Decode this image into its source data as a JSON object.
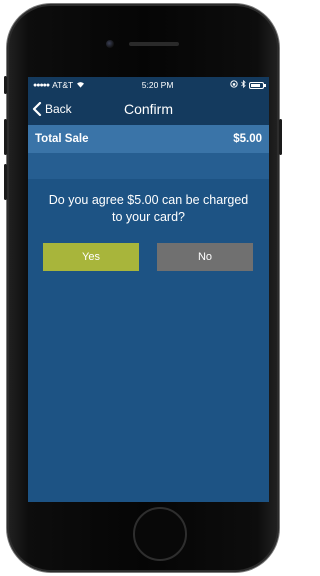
{
  "status_bar": {
    "carrier": "AT&T",
    "signal_dots": "●●●●●",
    "time": "5:20 PM"
  },
  "nav": {
    "back_label": "Back",
    "title": "Confirm"
  },
  "sale": {
    "label": "Total Sale",
    "amount": "$5.00"
  },
  "prompt": {
    "text": "Do you agree $5.00 can be charged to your card?"
  },
  "buttons": {
    "yes": "Yes",
    "no": "No"
  },
  "colors": {
    "screen_bg": "#1d5384",
    "nav_bg": "#143a5e",
    "sale_row_bg": "#3a74a8",
    "yes_button": "#a8b53b",
    "no_button": "#707070"
  },
  "icons": [
    "signal-dots-icon",
    "wifi-icon",
    "lock-rotation-icon",
    "bluetooth-icon",
    "battery-icon",
    "chevron-left-icon"
  ]
}
